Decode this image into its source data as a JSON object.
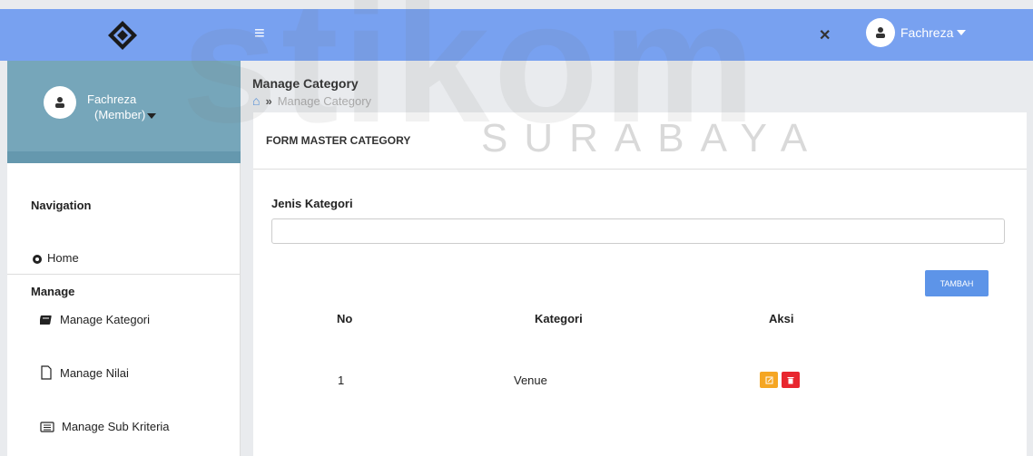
{
  "header": {
    "menu_icon": "hamburger-icon",
    "expand_icon": "fullscreen-icon",
    "user_name": "Fachreza"
  },
  "sidebar": {
    "profile_name": "Fachreza",
    "profile_role": "(Member)",
    "navigation_title": "Navigation",
    "home_label": "Home",
    "manage_title": "Manage",
    "items": [
      {
        "label": "Manage Kategori",
        "icon": "book-icon"
      },
      {
        "label": "Manage Nilai",
        "icon": "file-icon"
      },
      {
        "label": "Manage Sub Kriteria",
        "icon": "list-icon"
      }
    ]
  },
  "main": {
    "page_title": "Manage Category",
    "breadcrumb_current": "Manage Category",
    "panel_title": "FORM MASTER CATEGORY",
    "field_label": "Jenis Kategori",
    "field_value": "",
    "add_button": "TAMBAH",
    "table": {
      "headers": [
        "No",
        "Kategori",
        "Aksi"
      ],
      "rows": [
        {
          "no": "1",
          "kategori": "Venue"
        }
      ]
    }
  },
  "watermark": {
    "big": "stikom",
    "small": "SURABAYA"
  },
  "colors": {
    "topbar": "#78a1f0",
    "sidebar_profile": "#76a6ba",
    "button_primary": "#5d94e8",
    "edit": "#f5a623",
    "delete": "#e8262e"
  }
}
